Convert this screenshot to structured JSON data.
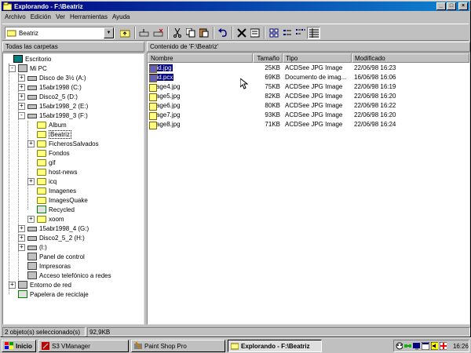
{
  "window": {
    "title": "Explorando - F:\\Beatriz",
    "controls": {
      "minimize": "_",
      "maximize": "□",
      "close": "×"
    }
  },
  "menu": [
    "Archivo",
    "Edición",
    "Ver",
    "Herramientas",
    "Ayuda"
  ],
  "toolbar": {
    "address_value": "Beatriz",
    "buttons": [
      "up-folder-icon",
      "map-drive-icon",
      "disconnect-drive-icon",
      "cut-icon",
      "copy-icon",
      "paste-icon",
      "undo-icon",
      "delete-icon",
      "properties-icon",
      "large-icons-icon",
      "small-icons-icon",
      "list-view-icon",
      "details-view-icon"
    ]
  },
  "left_pane": {
    "header": "Todas las carpetas",
    "tree": [
      {
        "label": "Escritorio",
        "level": 0,
        "icon": "desktop-icon"
      },
      {
        "label": "Mi PC",
        "level": 1,
        "icon": "computer-icon",
        "expander": "-"
      },
      {
        "label": "Disco de 3½ (A:)",
        "level": 2,
        "icon": "floppy-icon",
        "expander": "+"
      },
      {
        "label": "15abr1998 (C:)",
        "level": 2,
        "icon": "drive-icon",
        "expander": "+"
      },
      {
        "label": "Disco2_5 (D:)",
        "level": 2,
        "icon": "drive-icon",
        "expander": "+"
      },
      {
        "label": "15abr1998_2 (E:)",
        "level": 2,
        "icon": "drive-icon",
        "expander": "+"
      },
      {
        "label": "15abr1998_3 (F:)",
        "level": 2,
        "icon": "drive-icon",
        "expander": "-"
      },
      {
        "label": "Album",
        "level": 3,
        "icon": "folder-icon"
      },
      {
        "label": "Beatriz",
        "level": 3,
        "icon": "open-folder-icon"
      },
      {
        "label": "FicherosSalvados",
        "level": 3,
        "icon": "folder-icon",
        "expander": "+"
      },
      {
        "label": "Fondos",
        "level": 3,
        "icon": "folder-icon"
      },
      {
        "label": "gif",
        "level": 3,
        "icon": "folder-icon"
      },
      {
        "label": "host-news",
        "level": 3,
        "icon": "folder-icon"
      },
      {
        "label": "icq",
        "level": 3,
        "icon": "folder-icon",
        "expander": "+"
      },
      {
        "label": "Imagenes",
        "level": 3,
        "icon": "folder-icon"
      },
      {
        "label": "ImagesQuake",
        "level": 3,
        "icon": "folder-icon"
      },
      {
        "label": "Recycled",
        "level": 3,
        "icon": "recycle-icon"
      },
      {
        "label": "xoom",
        "level": 3,
        "icon": "folder-icon",
        "expander": "+"
      },
      {
        "label": "15abr1998_4 (G:)",
        "level": 2,
        "icon": "drive-icon",
        "expander": "+"
      },
      {
        "label": "Disco2_5_2 (H:)",
        "level": 2,
        "icon": "drive-icon",
        "expander": "+"
      },
      {
        "label": "(I:)",
        "level": 2,
        "icon": "cd-drive-icon",
        "expander": "+"
      },
      {
        "label": "Panel de control",
        "level": 2,
        "icon": "control-panel-icon"
      },
      {
        "label": "Impresoras",
        "level": 2,
        "icon": "printer-icon"
      },
      {
        "label": "Acceso telefónico a redes",
        "level": 2,
        "icon": "dialup-icon"
      },
      {
        "label": "Entorno de red",
        "level": 1,
        "icon": "network-icon",
        "expander": "+"
      },
      {
        "label": "Papelera de reciclaje",
        "level": 1,
        "icon": "recycle-bin-icon"
      }
    ]
  },
  "right_pane": {
    "header": "Contenido de 'F:\\Beatriz'",
    "columns": {
      "name": "Nombre",
      "size": "Tamaño",
      "type": "Tipo",
      "modified": "Modificado"
    },
    "files": [
      {
        "name": "acid.jpg",
        "size": "25KB",
        "type": "ACDSee JPG Image",
        "modified": "22/06/98 16:23",
        "selected": true
      },
      {
        "name": "acid.pcx",
        "size": "69KB",
        "type": "Documento de imag...",
        "modified": "16/06/98 16:06",
        "selected": true
      },
      {
        "name": "Image4.jpg",
        "size": "75KB",
        "type": "ACDSee JPG Image",
        "modified": "22/06/98 16:19",
        "selected": false
      },
      {
        "name": "Image5.jpg",
        "size": "82KB",
        "type": "ACDSee JPG Image",
        "modified": "22/06/98 16:20",
        "selected": false
      },
      {
        "name": "Image6.jpg",
        "size": "80KB",
        "type": "ACDSee JPG Image",
        "modified": "22/06/98 16:22",
        "selected": false
      },
      {
        "name": "Image7.jpg",
        "size": "93KB",
        "type": "ACDSee JPG Image",
        "modified": "22/06/98 16:20",
        "selected": false
      },
      {
        "name": "Image8.jpg",
        "size": "71KB",
        "type": "ACDSee JPG Image",
        "modified": "22/06/98 16:24",
        "selected": false
      }
    ]
  },
  "status": {
    "selection": "2 objeto(s) seleccionado(s)",
    "size": "92,9KB"
  },
  "taskbar": {
    "start": "Inicio",
    "tasks": [
      {
        "label": "S3 VManager",
        "active": false
      },
      {
        "label": "Paint Shop Pro",
        "active": false
      },
      {
        "label": "Explorando - F:\\Beatriz",
        "active": true
      }
    ],
    "clock": "16:26"
  }
}
